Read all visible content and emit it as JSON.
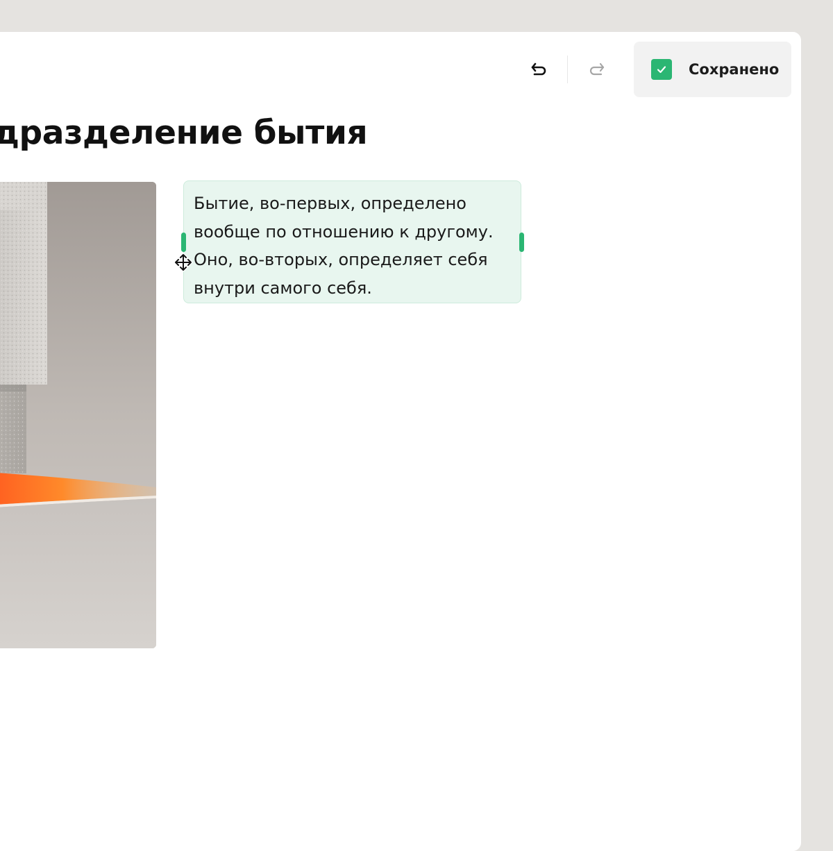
{
  "toolbar": {
    "undo_icon": "undo-arrow-icon",
    "redo_icon": "redo-arrow-icon",
    "save_status": {
      "icon": "checkmark-icon",
      "label": "Сохранено",
      "color": "#2bb673"
    }
  },
  "document": {
    "title": "дразделение бытия",
    "image": {
      "description_icon": "stone-block-photo"
    },
    "text_block": {
      "text": "Бытие, во-первых, определено вообще по отношению к другому. Оно, во-вторых, определяет себя внутри самого себя.",
      "background": "#e8f6ef",
      "handle_color": "#2bb673"
    }
  },
  "colors": {
    "accent": "#2bb673",
    "page_background": "#e5e3e0",
    "panel_background": "#ffffff"
  }
}
